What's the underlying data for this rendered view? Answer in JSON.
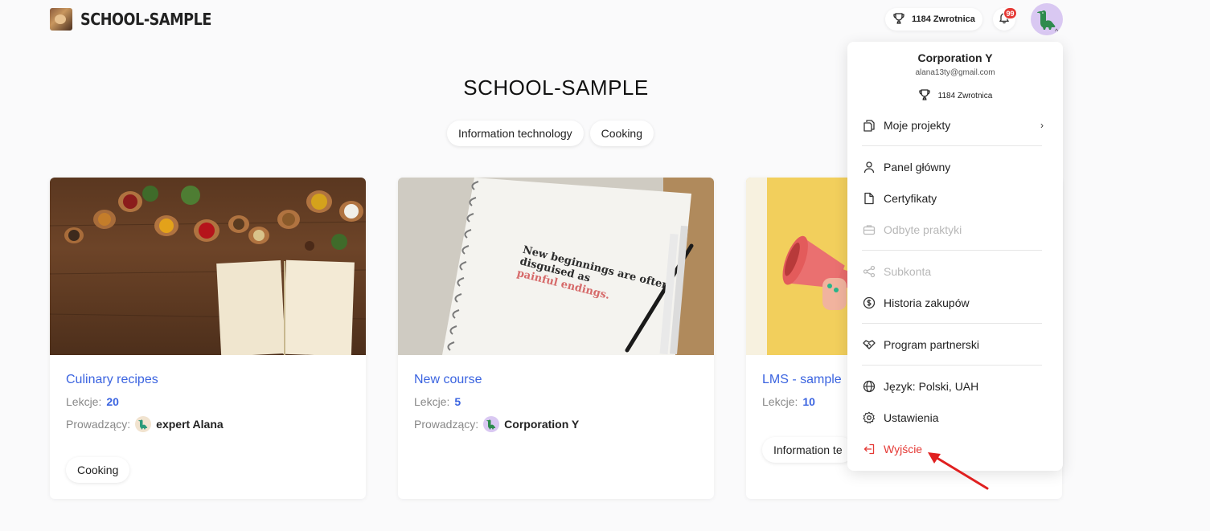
{
  "header": {
    "logo_text": "SCHOOL-SAMPLE",
    "points": "1184 Zwrotnica",
    "notifications_badge": "99"
  },
  "main": {
    "title": "SCHOOL-SAMPLE",
    "categories": [
      "Information technology",
      "Cooking"
    ]
  },
  "courses": [
    {
      "title": "Culinary recipes",
      "lessons_label": "Lekcje:",
      "lessons": "20",
      "teacher_label": "Prowadzący:",
      "teacher": "expert Alana",
      "tag": "Cooking"
    },
    {
      "title": "New course",
      "lessons_label": "Lekcje:",
      "lessons": "5",
      "teacher_label": "Prowadzący:",
      "teacher": "Corporation Y",
      "notebook_line1": "New beginnings are often",
      "notebook_line2": "disguised as",
      "notebook_line3": "painful endings."
    },
    {
      "title": "LMS - sample",
      "lessons_label": "Lekcje:",
      "lessons": "10",
      "tag": "Information te"
    }
  ],
  "dropdown": {
    "name": "Corporation Y",
    "email": "alana13ty@gmail.com",
    "points": "1184 Zwrotnica",
    "items": [
      {
        "label": "Moje projekty",
        "icon": "copy-icon"
      },
      {
        "label": "Panel główny",
        "icon": "user-icon"
      },
      {
        "label": "Certyfikaty",
        "icon": "file-icon"
      },
      {
        "label": "Odbyte praktyki",
        "icon": "briefcase-icon"
      },
      {
        "label": "Subkonta",
        "icon": "share-icon"
      },
      {
        "label": "Historia zakupów",
        "icon": "dollar-icon"
      },
      {
        "label": "Program partnerski",
        "icon": "handshake-icon"
      },
      {
        "label": "Język: Polski, UAH",
        "icon": "globe-icon"
      },
      {
        "label": "Ustawienia",
        "icon": "gear-icon"
      },
      {
        "label": "Wyjście",
        "icon": "logout-icon"
      }
    ]
  },
  "colors": {
    "accent": "#3b64e0",
    "danger": "#e53935",
    "avatar_bg": "#d9c8f2"
  }
}
